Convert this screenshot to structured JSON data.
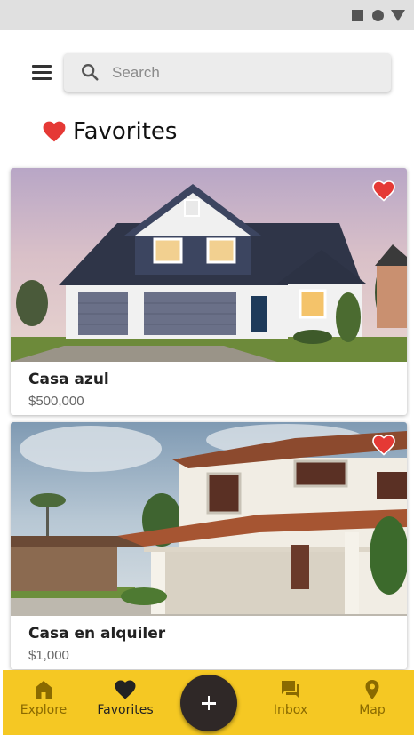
{
  "status_bar": {
    "icons": [
      "square-icon",
      "circle-icon",
      "triangle-icon"
    ]
  },
  "header": {
    "menu_icon": "menu-icon",
    "search": {
      "placeholder": "Search",
      "value": "",
      "icon": "search-icon"
    }
  },
  "page": {
    "title": "Favorites",
    "title_icon": "heart-icon"
  },
  "listings": [
    {
      "name": "Casa azul",
      "price": "$500,000",
      "favorited": true,
      "image": "blue-house-photo"
    },
    {
      "name": "Casa en alquiler",
      "price": "$1,000",
      "favorited": true,
      "image": "white-house-photo"
    }
  ],
  "bottom_nav": {
    "items": [
      {
        "label": "Explore",
        "icon": "home-icon",
        "active": false
      },
      {
        "label": "Favorites",
        "icon": "heart-icon",
        "active": true
      },
      {
        "label": "Inbox",
        "icon": "chat-icon",
        "active": false
      },
      {
        "label": "Map",
        "icon": "location-pin-icon",
        "active": false
      }
    ],
    "fab_icon": "plus-icon"
  },
  "colors": {
    "accent": "#f5c823",
    "favorite_red": "#e53935",
    "fab": "#2f2827",
    "status_bar": "#e0e0e0"
  }
}
